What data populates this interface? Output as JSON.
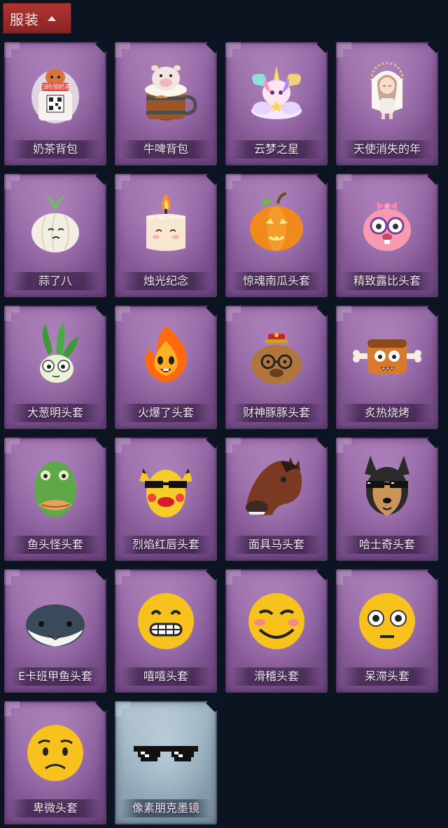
{
  "header": {
    "title": "服装"
  },
  "items": [
    {
      "label": "奶茶背包"
    },
    {
      "label": "牛啤背包"
    },
    {
      "label": "云梦之星"
    },
    {
      "label": "天使消失的年"
    },
    {
      "label": "蒜了八"
    },
    {
      "label": "烛光纪念"
    },
    {
      "label": "惊魂南瓜头套"
    },
    {
      "label": "精致露比头套"
    },
    {
      "label": "大葱明头套"
    },
    {
      "label": "火爆了头套"
    },
    {
      "label": "财神豚豚头套"
    },
    {
      "label": "炙热烧烤"
    },
    {
      "label": "鱼头怪头套"
    },
    {
      "label": "烈焰红唇头套"
    },
    {
      "label": "面具马头套"
    },
    {
      "label": "哈士奇头套"
    },
    {
      "label": "E卡班甲鱼头套"
    },
    {
      "label": "嘻嘻头套"
    },
    {
      "label": "滑稽头套"
    },
    {
      "label": "呆滞头套"
    },
    {
      "label": "卑微头套"
    },
    {
      "label": "像素朋克墨镜"
    }
  ],
  "qr_text": "扫码领奶茶",
  "colors": {
    "rarity_purple": "#8a5f9c",
    "rarity_blue": "#93a9b8",
    "tab_red": "#b23434"
  }
}
